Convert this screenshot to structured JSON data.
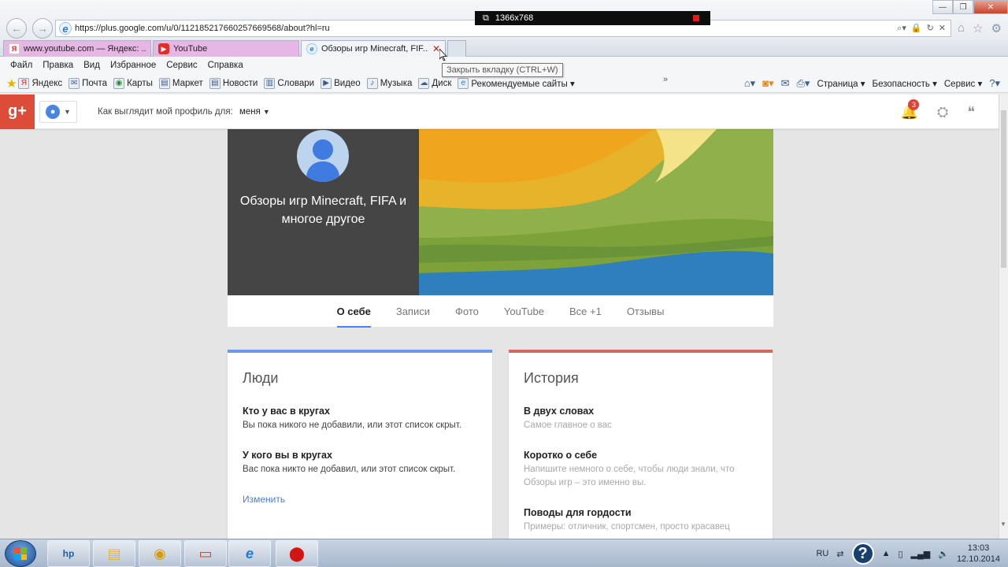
{
  "browser": {
    "url": "https://plus.google.com/u/0/112185217660257669568/about?hl=ru",
    "recorder_resolution": "1366x768",
    "tabs": [
      {
        "label": "www.youtube.com — Яндекс: ...",
        "favicon": "yandex-icon"
      },
      {
        "label": "YouTube",
        "favicon": "youtube-icon"
      },
      {
        "label": "Обзоры игр Minecraft, FIF...",
        "favicon": "ie-page-icon",
        "close": "✕"
      }
    ],
    "tooltip": "Закрыть вкладку (CTRL+W)",
    "menu": [
      "Файл",
      "Правка",
      "Вид",
      "Избранное",
      "Сервис",
      "Справка"
    ],
    "favorites": [
      {
        "label": "Яндекс",
        "icon": "yandex-icon"
      },
      {
        "label": "Почта",
        "icon": "mail-icon"
      },
      {
        "label": "Карты",
        "icon": "maps-icon"
      },
      {
        "label": "Маркет",
        "icon": "market-icon"
      },
      {
        "label": "Новости",
        "icon": "news-icon"
      },
      {
        "label": "Словари",
        "icon": "dictionary-icon"
      },
      {
        "label": "Видео",
        "icon": "video-icon"
      },
      {
        "label": "Музыка",
        "icon": "music-icon"
      },
      {
        "label": "Диск",
        "icon": "disk-icon"
      },
      {
        "label": "Рекомендуемые сайты ▾",
        "icon": "suggested-sites-icon"
      }
    ],
    "command_bar": {
      "page": "Страница",
      "security": "Безопасность",
      "tools": "Сервис"
    }
  },
  "gplus": {
    "logo": "g+",
    "view_as_label": "Как выглядит мой профиль для:",
    "view_as_value": "меня",
    "notifications_count": "3",
    "accent": "#dd4b39"
  },
  "profile": {
    "title": "Обзоры игр Minecraft, FIFA и многое другое",
    "tabs": [
      "О себе",
      "Записи",
      "Фото",
      "YouTube",
      "Все +1",
      "Отзывы"
    ],
    "active_tab": "О себе"
  },
  "people_card": {
    "title": "Люди",
    "sections": [
      {
        "title": "Кто у вас в кругах",
        "text": "Вы пока никого не добавили, или этот список скрыт."
      },
      {
        "title": "У кого вы в кругах",
        "text": "Вас пока никто не добавил, или этот список скрыт."
      }
    ],
    "edit": "Изменить",
    "accent": "#6a9bea"
  },
  "story_card": {
    "title": "История",
    "sections": [
      {
        "title": "В двух словах",
        "text": "Самое главное о вас"
      },
      {
        "title": "Коротко о себе",
        "text": "Напишите немного о себе, чтобы люди знали, что Обзоры игр – это именно вы."
      },
      {
        "title": "Поводы для гордости",
        "text": "Примеры: отличник, спортсмен, просто красавец"
      }
    ],
    "accent": "#d2695c"
  },
  "taskbar": {
    "lang": "RU",
    "time": "13:03",
    "date": "12.10.2014"
  }
}
